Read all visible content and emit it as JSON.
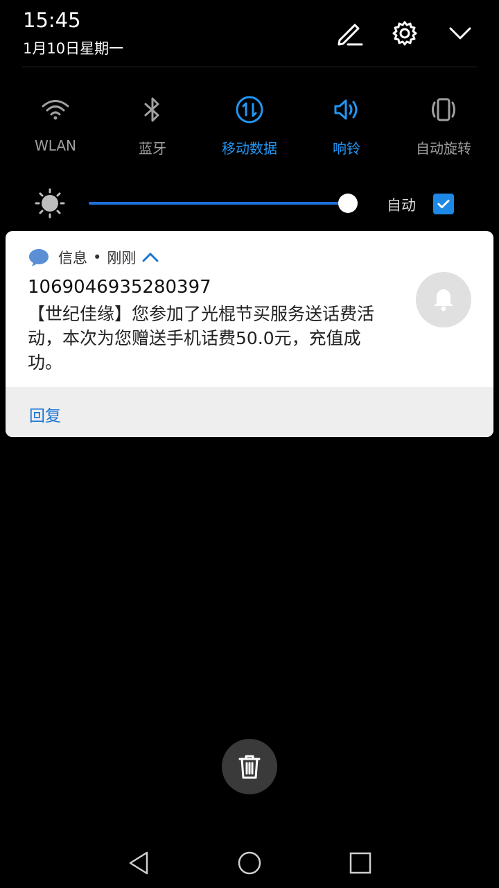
{
  "status": {
    "time": "15:45",
    "date": "1月10日星期一"
  },
  "header_icons": [
    "edit-icon",
    "gear-icon",
    "chevron-down-icon"
  ],
  "toggles": [
    {
      "label": "WLAN",
      "icon": "wifi-icon",
      "active": false
    },
    {
      "label": "蓝牙",
      "icon": "bluetooth-icon",
      "active": false
    },
    {
      "label": "移动数据",
      "icon": "mobile-data-icon",
      "active": true
    },
    {
      "label": "响铃",
      "icon": "ring-volume-icon",
      "active": true
    },
    {
      "label": "自动旋转",
      "icon": "auto-rotate-icon",
      "active": false
    }
  ],
  "brightness": {
    "level": 1.0,
    "auto_label": "自动",
    "auto_checked": true
  },
  "notification": {
    "app_name": "信息",
    "separator": "•",
    "time_ago": "刚刚",
    "sender": "1069046935280397",
    "body": "【世纪佳缘】您参加了光棍节买服务送话费活动，本次为您赠送手机话费50.0元，充值成功。",
    "reply_label": "回复"
  },
  "colors": {
    "accent": "#1e88e5",
    "active_text": "#2196f3",
    "inactive_text": "#a0a0a0",
    "background": "#000000",
    "card": "#ffffff"
  }
}
